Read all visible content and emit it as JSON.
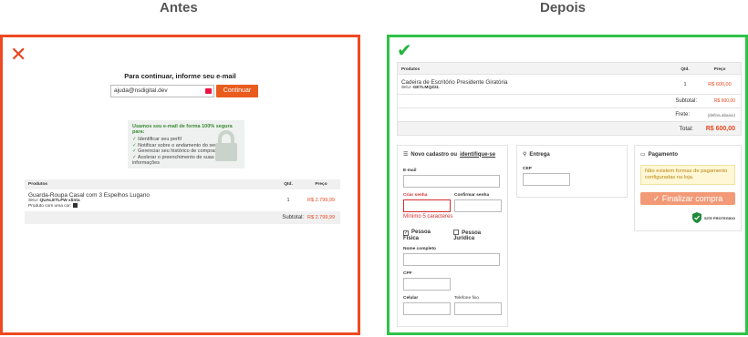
{
  "headings": {
    "before": "Antes",
    "after": "Depois"
  },
  "before": {
    "title": "Para continuar, informe seu e-mail",
    "email_value": "ajuda@nsdigital.dev",
    "continue_label": "Continuar",
    "secure": {
      "title": "Usamos seu e-mail de forma 100% segura para:",
      "items": [
        "Identificar seu perfil",
        "Notificar sobre o andamento do seu pedido",
        "Gerenciar seu histórico de compras",
        "Acelerar o preenchimento de suas informações"
      ]
    },
    "table": {
      "headers": {
        "product": "Produtos",
        "qty": "Qtd.",
        "price": "Preço"
      },
      "item": {
        "name": "Guarda-Roupa Casal com 3 Espelhos Lugano",
        "sku_label": "SKU:",
        "sku": "QUALETLFW xlinta",
        "color_label": "Produto com uma cor:",
        "qty": "1",
        "price": "R$ 2.799,99"
      },
      "subtotal_label": "Subtotal:",
      "subtotal": "R$ 2.799,99"
    }
  },
  "after": {
    "table": {
      "headers": {
        "product": "Produtos",
        "qty": "Qtd.",
        "price": "Preço"
      },
      "item": {
        "name": "Cadeira de Escritório Presidente Giratória",
        "sku_label": "SKU:",
        "sku": "GETLMQZ2L",
        "qty": "1",
        "price": "R$ 600,00"
      },
      "subtotal_label": "Subtotal:",
      "subtotal": "R$ 600,00",
      "shipping_label": "Frete:",
      "shipping": "(defina abaixo)",
      "total_label": "Total:",
      "total": "R$ 600,00"
    },
    "register": {
      "title_prefix": "Novo cadastro ou",
      "title_link": "identifique-se",
      "email_label": "E-mail",
      "password_label": "Criar senha",
      "confirm_label": "Confirmar senha",
      "password_error": "Mínimo 5 caracteres",
      "pf_label": "Pessoa Física",
      "pj_label": "Pessoa Jurídica",
      "name_label": "Nome completo",
      "cpf_label": "CPF",
      "cell_label": "Celular",
      "phone_label": "Telefone fixo"
    },
    "delivery": {
      "title": "Entrega",
      "cep_label": "CEP"
    },
    "payment": {
      "title": "Pagamento",
      "warning": "Não existem formas de pagamento configuradas na loja.",
      "finish_label": "Finalizar compra",
      "badge_small": "SITE PROTEGIDO"
    }
  },
  "colors": {
    "before_border": "#ee4922",
    "after_border": "#2fc248",
    "accent": "#e95c1e"
  }
}
